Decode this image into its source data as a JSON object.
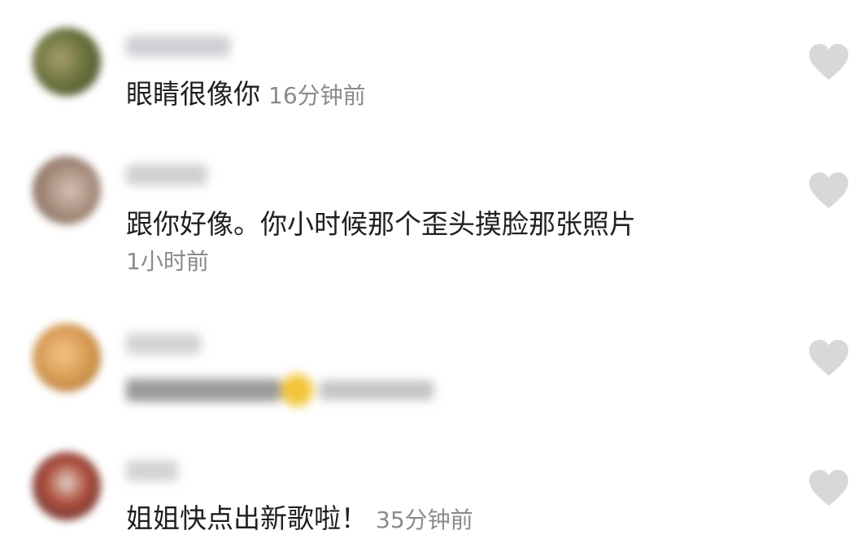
{
  "comments": [
    {
      "text": "眼睛很像你",
      "time": "16分钟前",
      "like_icon": "heart-icon",
      "avatar_color": "#5e6a3a",
      "username_blurred": true
    },
    {
      "text": "跟你好像。你小时候那个歪头摸脸那张照片",
      "time": "1小时前",
      "like_icon": "heart-icon",
      "avatar_color": "#8a7466",
      "username_blurred": true
    },
    {
      "text_blurred": true,
      "emoji_icon": "crying-laughing-emoji-icon",
      "like_icon": "heart-icon",
      "avatar_color": "#c98f4c",
      "username_blurred": true
    },
    {
      "text": "姐姐快点出新歌啦！",
      "time": "35分钟前",
      "like_icon": "heart-icon",
      "avatar_color": "#7a2e2a",
      "username_blurred": true
    }
  ],
  "colors": {
    "text": "#1f1f1f",
    "time": "#8a8a8a",
    "heart": "#d8d8d8",
    "blurred_name": "#d0d0d0"
  }
}
